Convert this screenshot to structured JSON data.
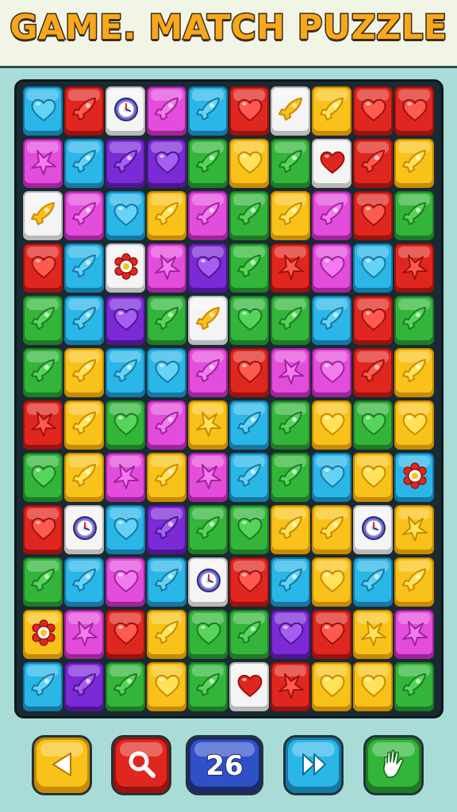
{
  "header": {
    "title": "GAME. MATCH PUZZLE"
  },
  "colors": {
    "red": "#e0271f",
    "green": "#33b53a",
    "blue": "#2bb6e8",
    "yellow": "#f9c21a",
    "magenta": "#e34ddb",
    "purple": "#7b2ad6",
    "white": "#f4f4f4",
    "orange": "#f7a81b"
  },
  "grid": {
    "rows": 12,
    "cols": 10,
    "tiles": [
      [
        "blue:heart",
        "red:rocket",
        "white:clock",
        "magenta:rocket",
        "blue:rocket",
        "red:heart",
        "white:rocket",
        "yellow:rocket",
        "red:heart",
        "red:heart"
      ],
      [
        "magenta:star",
        "blue:rocket",
        "purple:rocket",
        "purple:heart",
        "green:rocket",
        "yellow:heart",
        "green:rocket",
        "white:heart",
        "red:rocket",
        "yellow:rocket"
      ],
      [
        "white:rocket",
        "magenta:rocket",
        "blue:heart",
        "yellow:rocket",
        "magenta:rocket",
        "green:rocket",
        "yellow:rocket",
        "magenta:rocket",
        "red:heart",
        "green:rocket"
      ],
      [
        "red:heart",
        "blue:rocket",
        "white:flower",
        "magenta:star",
        "purple:heart",
        "green:rocket",
        "red:star",
        "magenta:heart",
        "blue:heart",
        "red:star"
      ],
      [
        "green:rocket",
        "blue:rocket",
        "purple:heart",
        "green:rocket",
        "white:rocket",
        "green:heart",
        "green:rocket",
        "blue:rocket",
        "red:heart",
        "green:rocket"
      ],
      [
        "green:rocket",
        "yellow:rocket",
        "blue:rocket",
        "blue:heart",
        "magenta:rocket",
        "red:heart",
        "magenta:star",
        "magenta:heart",
        "red:rocket",
        "yellow:rocket"
      ],
      [
        "red:star",
        "yellow:rocket",
        "green:heart",
        "magenta:rocket",
        "yellow:star",
        "blue:rocket",
        "green:rocket",
        "yellow:heart",
        "green:heart",
        "yellow:heart"
      ],
      [
        "green:heart",
        "yellow:rocket",
        "magenta:star",
        "yellow:rocket",
        "magenta:star",
        "blue:rocket",
        "green:rocket",
        "blue:heart",
        "yellow:heart",
        "blue:flower"
      ],
      [
        "red:heart",
        "white:clock",
        "blue:heart",
        "purple:rocket",
        "green:rocket",
        "green:heart",
        "yellow:rocket",
        "yellow:rocket",
        "white:clock",
        "yellow:star"
      ],
      [
        "green:rocket",
        "blue:rocket",
        "magenta:heart",
        "blue:rocket",
        "white:clock",
        "red:heart",
        "blue:rocket",
        "yellow:heart",
        "blue:rocket",
        "yellow:rocket"
      ],
      [
        "yellow:flower",
        "magenta:star",
        "red:heart",
        "yellow:rocket",
        "green:heart",
        "green:rocket",
        "purple:heart",
        "red:heart",
        "yellow:star",
        "magenta:star"
      ],
      [
        "blue:rocket",
        "purple:rocket",
        "green:rocket",
        "yellow:heart",
        "green:rocket",
        "white:heart",
        "red:star",
        "yellow:heart",
        "yellow:heart",
        "green:rocket"
      ]
    ]
  },
  "controls": {
    "back": {
      "icon": "back-arrow-icon",
      "color": "#f9c21a"
    },
    "search": {
      "icon": "magnifier-icon",
      "color": "#e0271f"
    },
    "moves": {
      "label": "26",
      "color": "#3050c8"
    },
    "skip": {
      "icon": "fast-forward-icon",
      "color": "#2bb6e8"
    },
    "hint": {
      "icon": "hand-icon",
      "color": "#33b53a"
    }
  }
}
